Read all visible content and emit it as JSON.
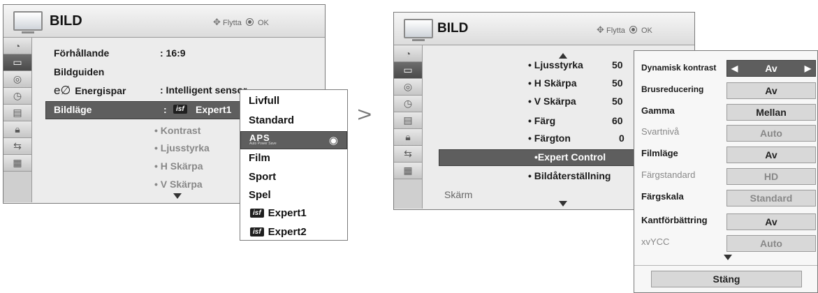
{
  "left": {
    "title": "BILD",
    "nav_move": "Flytta",
    "nav_ok": "OK",
    "rows": [
      {
        "label": "Förhållande",
        "value": ": 16:9"
      },
      {
        "label": "Bildguiden",
        "value": ""
      },
      {
        "label": "Energispar",
        "value": ": Intelligent sensor"
      },
      {
        "label": "Bildläge",
        "value": ":",
        "value2": "Expert1"
      }
    ],
    "subitems": [
      "• Kontrast",
      "• Ljusstyrka",
      "• H Skärpa",
      "• V Skärpa"
    ],
    "eco_symbol": "e∅"
  },
  "popup": {
    "items": [
      "Livfull",
      "Standard",
      "APS",
      "Film",
      "Sport",
      "Spel",
      "Expert1",
      "Expert2"
    ],
    "isf_badge": "isf",
    "aps_caption": "Auto Power Save"
  },
  "arrow_symbol": ">",
  "right": {
    "title": "BILD",
    "nav_move": "Flytta",
    "nav_ok": "OK",
    "rows": [
      {
        "label": "• Ljusstyrka",
        "value": "50"
      },
      {
        "label": "• H Skärpa",
        "value": "50"
      },
      {
        "label": "• V Skärpa",
        "value": "50"
      },
      {
        "label": "• Färg",
        "value": "60"
      },
      {
        "label": "• Färgton",
        "value": "0"
      }
    ],
    "selected": "•Expert Control",
    "reset": "• Bildåterställning",
    "screen": "Skärm"
  },
  "expert": {
    "rows": [
      {
        "label": "Dynamisk kontrast",
        "value": "Av",
        "dim": false
      },
      {
        "label": "Brusreducering",
        "value": "Av",
        "dim": false
      },
      {
        "label": "Gamma",
        "value": "Mellan",
        "dim": false
      },
      {
        "label": "Svartnivå",
        "value": "Auto",
        "dim": true
      },
      {
        "label": "Filmläge",
        "value": "Av",
        "dim": false
      },
      {
        "label": "Färgstandard",
        "value": "HD",
        "dim": true
      },
      {
        "label": "Färgskala",
        "value": "Standard",
        "dim": true
      },
      {
        "label": "Kantförbättring",
        "value": "Av",
        "dim": false
      },
      {
        "label": "xvYCC",
        "value": "Auto",
        "dim": true
      }
    ],
    "close": "Stäng",
    "left_arrow": "◀",
    "right_arrow": "▶"
  }
}
